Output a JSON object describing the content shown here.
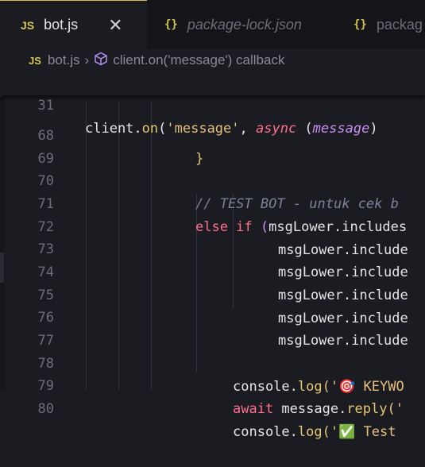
{
  "tabs": [
    {
      "icon": "JS",
      "label": "bot.js",
      "active": true
    },
    {
      "icon": "{}",
      "label": "package-lock.json",
      "active": false
    },
    {
      "icon": "{}",
      "label": "packag",
      "active": false
    }
  ],
  "breadcrumb": {
    "file": "bot.js",
    "symbol": "client.on('message') callback"
  },
  "sticky": {
    "line_number": "31",
    "code": {
      "a": "client.",
      "b": "on",
      "c": "(",
      "d": "'message'",
      "e": ", ",
      "f": "async",
      "g": " (",
      "h": "message",
      "i": ")"
    }
  },
  "lines": [
    {
      "n": "68",
      "t1": "}"
    },
    {
      "n": "69"
    },
    {
      "n": "70",
      "t1": "// TEST BOT - untuk cek b"
    },
    {
      "n": "71",
      "t1": "else if",
      "t2": " (",
      "t3": "msgLower.includes"
    },
    {
      "n": "72",
      "t1": "msgLower.include"
    },
    {
      "n": "73",
      "t1": "msgLower.include"
    },
    {
      "n": "74",
      "t1": "msgLower.include"
    },
    {
      "n": "75",
      "t1": "msgLower.include"
    },
    {
      "n": "76",
      "t1": "msgLower.include"
    },
    {
      "n": "77"
    },
    {
      "n": "78",
      "t1": "console.",
      "t2": "log",
      "t3": "('",
      "t4": "🎯",
      "t5": " KEYWO"
    },
    {
      "n": "79",
      "t1": "await",
      "t2": " message.",
      "t3": "reply",
      "t4": "('"
    },
    {
      "n": "80",
      "t1": "console.",
      "t2": "log",
      "t3": "('",
      "t4": "✅",
      "t5": " Test"
    }
  ]
}
